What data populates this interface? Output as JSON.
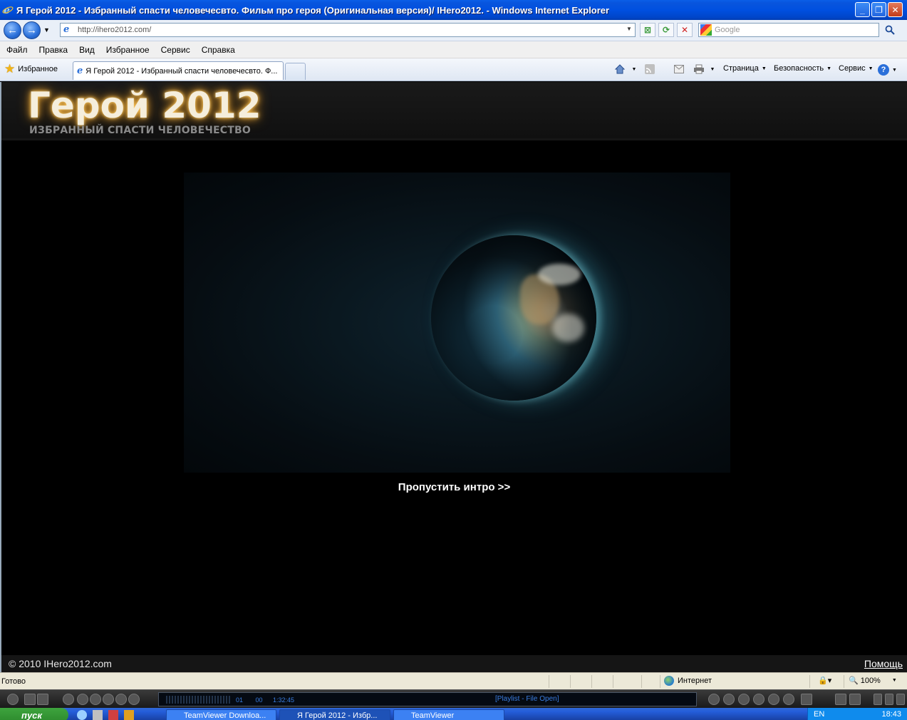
{
  "window": {
    "title": "Я Герой 2012 - Избранный спасти человечесвто. Фильм про героя (Оригинальная версия)/ IHero2012. - Windows Internet Explorer",
    "app_icon": "ie-icon",
    "buttons": {
      "minimize": "_",
      "maximize": "❐",
      "close": "✕"
    }
  },
  "toolbar": {
    "back_icon": "←",
    "forward_icon": "→",
    "address": "http://ihero2012.com/",
    "search_placeholder": "Google",
    "refresh_icon": "⟳",
    "stop_icon": "✕",
    "compat_icon": "⊠"
  },
  "menu": {
    "items": [
      "Файл",
      "Правка",
      "Вид",
      "Избранное",
      "Сервис",
      "Справка"
    ]
  },
  "tabs": {
    "favorites_label": "Избранное",
    "active_tab_label": "Я Герой 2012 - Избранный спасти человечесвто. Ф..."
  },
  "commandbar": {
    "page_label": "Страница",
    "safety_label": "Безопасность",
    "tools_label": "Сервис"
  },
  "site": {
    "logo_title": "Герой 2012",
    "logo_subtitle": "ИЗБРАННЫЙ СПАСТИ ЧЕЛОВЕЧЕСТВО",
    "skip_intro": "Пропустить интро >>",
    "copyright": "© 2010 IHero2012.com",
    "help_link": "Помощь"
  },
  "statusbar": {
    "status": "Готово",
    "zone": "Интернет",
    "zoom": "100%"
  },
  "player": {
    "playlist_text": "[Playlist - File Open]",
    "time": "1:32:45",
    "track": "01",
    "chapter": "00"
  },
  "taskbar": {
    "start_label": "пуск",
    "items": [
      "TeamViewer Downloa...",
      "Я Герой 2012 - Избр...",
      "TeamViewer"
    ],
    "language": "EN",
    "clock": "18:43"
  }
}
